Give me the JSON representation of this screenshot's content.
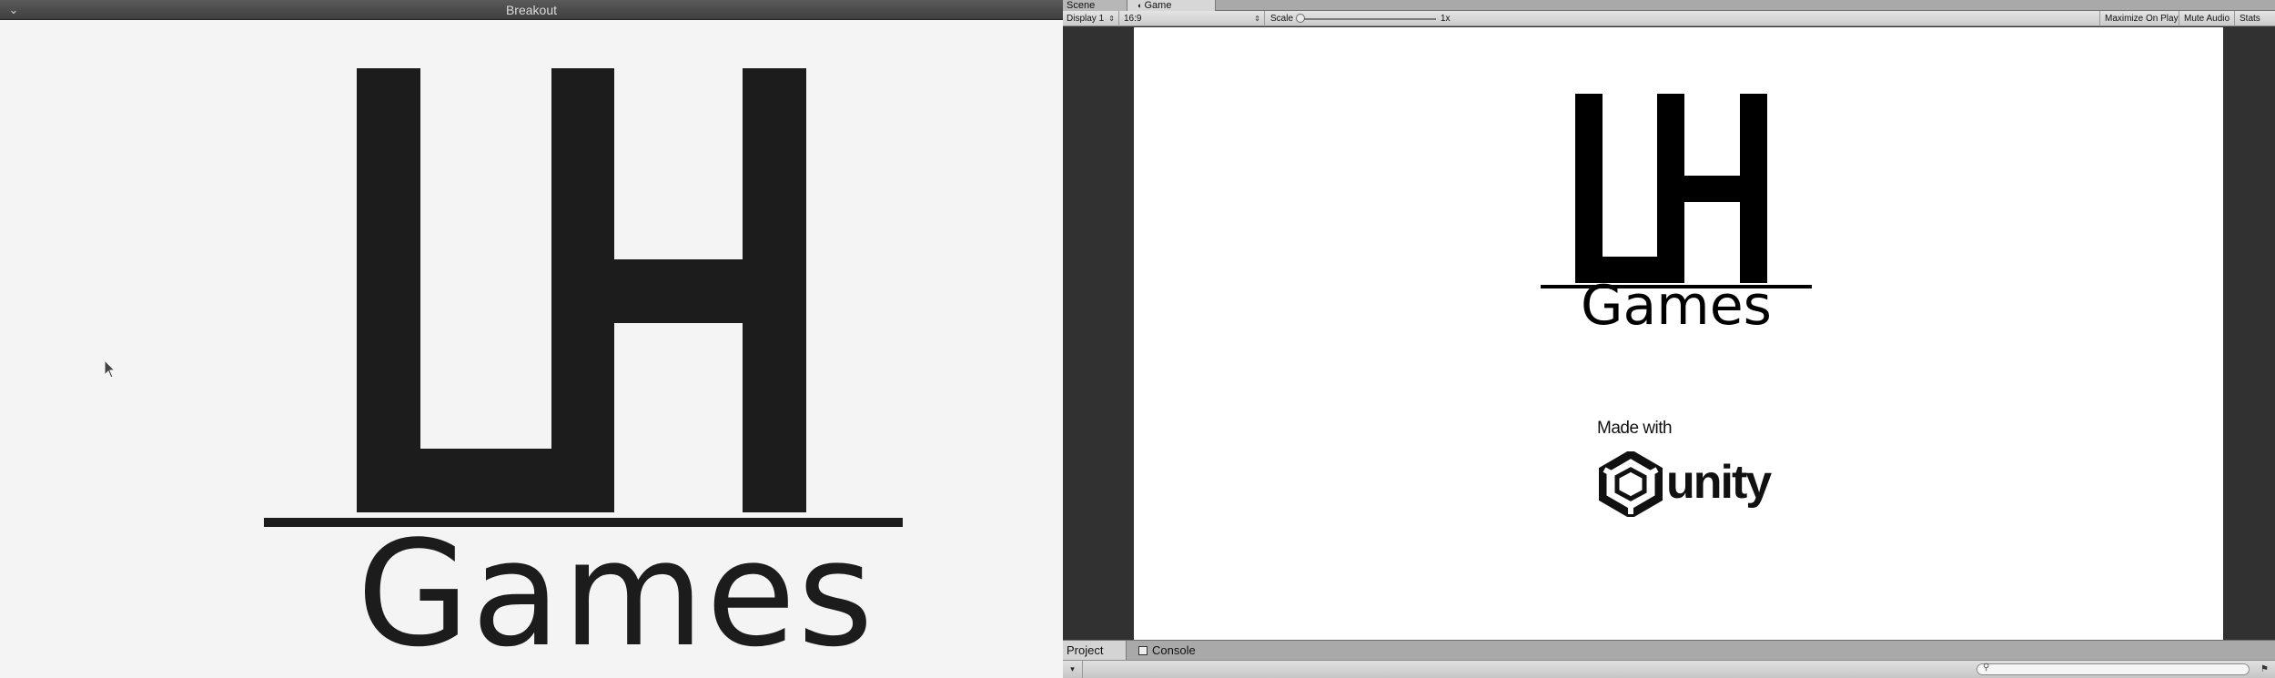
{
  "left_window": {
    "title": "Breakout",
    "menu_icon": "chevron-down-icon",
    "logo": {
      "games_text": "Games"
    },
    "colors": {
      "background": "#f4f4f4",
      "logo": "#1c1c1c",
      "titlebar": "#4a4a4a"
    }
  },
  "editor": {
    "tabs": {
      "scene": "Scene",
      "game": "Game"
    },
    "toolbar": {
      "display": "Display 1",
      "aspect": "16:9",
      "scale_label": "Scale",
      "scale_value": "1x",
      "maximize_on_play": "Maximize On Play",
      "mute_audio": "Mute Audio",
      "stats": "Stats"
    },
    "game_view": {
      "logo": {
        "games_text": "Games"
      },
      "splash": {
        "made_with": "Made with",
        "unity": "unity"
      }
    },
    "bottom_tabs": {
      "project": "Project",
      "console": "Console"
    },
    "bottom_toolbar": {
      "search_placeholder": ""
    },
    "colors": {
      "editor_dark": "#313131",
      "toolbar": "#d5d5d5",
      "canvas": "#ffffff"
    }
  }
}
